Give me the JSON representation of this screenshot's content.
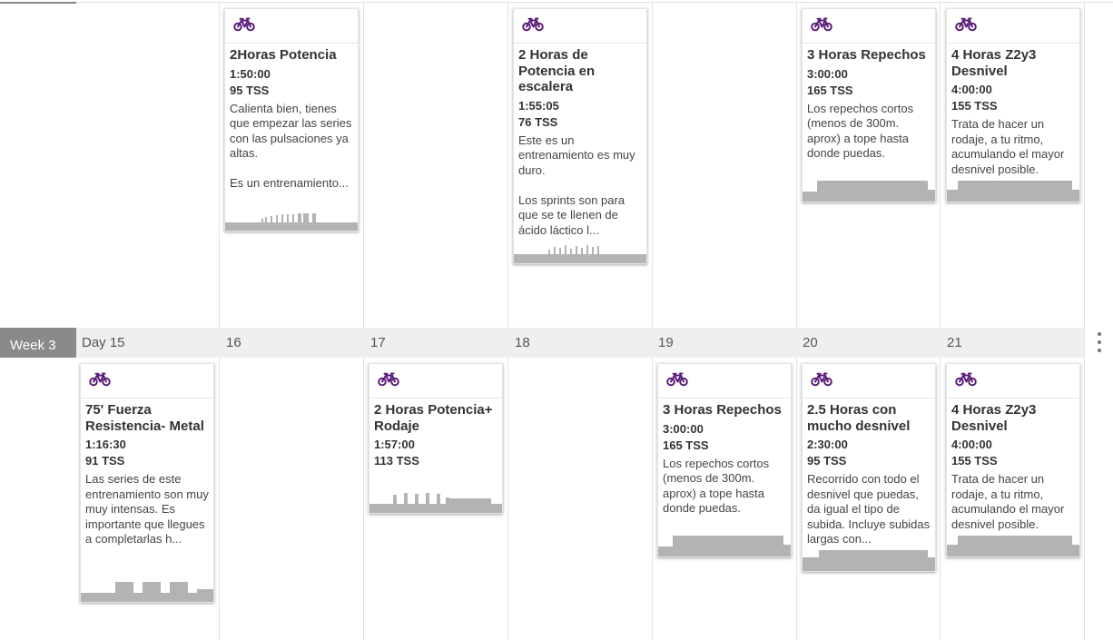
{
  "week": {
    "label": "Week 3"
  },
  "days": [
    "Day 15",
    "16",
    "17",
    "18",
    "19",
    "20",
    "21"
  ],
  "colors": {
    "accent": "#5b1f7a",
    "profile": "#b3b3b3",
    "week_label_bg": "#8a8a8a"
  },
  "icons": {
    "workout": "bike-icon",
    "menu": "kebab-icon"
  },
  "row1": [
    {
      "title": "2Horas Potencia",
      "duration": "1:50:00",
      "tss": "95 TSS",
      "desc": "Calienta bien, tienes que empezar las series con las pulsaciones ya altas.\n\nEs un entrenamiento..."
    },
    {
      "title": "2 Horas de Potencia en escalera",
      "duration": "1:55:05",
      "tss": "76 TSS",
      "desc": "Este es un entrenamiento es muy duro.\n\nLos sprints son para que se te llenen de ácido láctico l..."
    },
    {
      "title": "3 Horas Repechos",
      "duration": "3:00:00",
      "tss": "165 TSS",
      "desc": "Los repechos cortos (menos de 300m. aprox) a tope hasta donde puedas."
    },
    {
      "title": "4 Horas Z2y3 Desnivel",
      "duration": "4:00:00",
      "tss": "155 TSS",
      "desc": "Trata de hacer un rodaje, a tu ritmo, acumulando el mayor desnivel posible."
    }
  ],
  "row2": [
    {
      "title": "75' Fuerza Resistencia- Metal",
      "duration": "1:16:30",
      "tss": "91 TSS",
      "desc": "Las series de este entrenamiento son muy muy intensas. Es importante que llegues a completarlas h..."
    },
    {
      "title": "2 Horas Potencia+ Rodaje",
      "duration": "1:57:00",
      "tss": "113 TSS",
      "desc": ""
    },
    {
      "title": "3 Horas Repechos",
      "duration": "3:00:00",
      "tss": "165 TSS",
      "desc": "Los repechos cortos (menos de 300m. aprox) a tope hasta donde puedas."
    },
    {
      "title": "2.5 Horas con mucho desnivel",
      "duration": "2:30:00",
      "tss": "95 TSS",
      "desc": "Recorrido con todo el desnivel que puedas, da igual el tipo de subida. Incluye subidas largas con..."
    },
    {
      "title": "4 Horas Z2y3 Desnivel",
      "duration": "4:00:00",
      "tss": "155 TSS",
      "desc": "Trata de hacer un rodaje, a tu ritmo, acumulando el mayor desnivel posible."
    }
  ]
}
